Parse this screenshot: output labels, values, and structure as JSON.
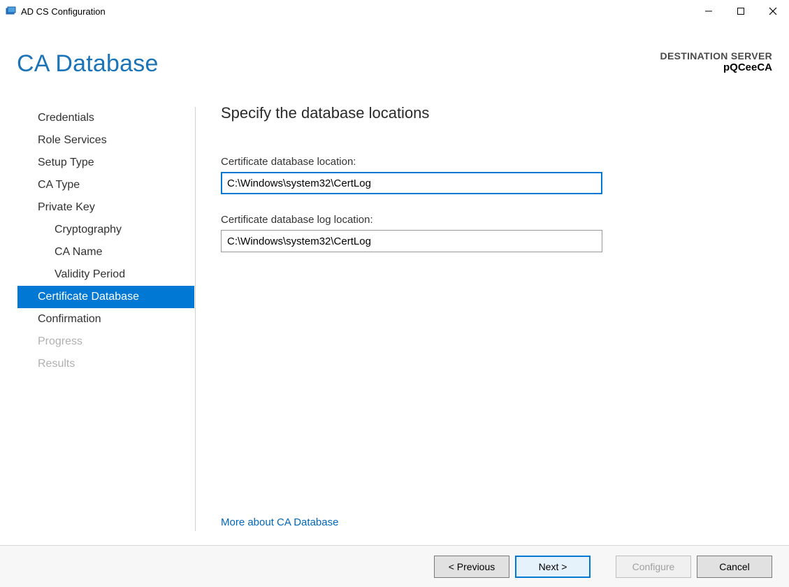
{
  "window": {
    "title": "AD CS Configuration",
    "icon": "server-manager-icon"
  },
  "header": {
    "page_title": "CA Database",
    "destination_label": "DESTINATION SERVER",
    "destination_value": "pQCeeCA"
  },
  "sidebar": {
    "items": [
      {
        "label": "Credentials",
        "sub": false,
        "selected": false,
        "disabled": false
      },
      {
        "label": "Role Services",
        "sub": false,
        "selected": false,
        "disabled": false
      },
      {
        "label": "Setup Type",
        "sub": false,
        "selected": false,
        "disabled": false
      },
      {
        "label": "CA Type",
        "sub": false,
        "selected": false,
        "disabled": false
      },
      {
        "label": "Private Key",
        "sub": false,
        "selected": false,
        "disabled": false
      },
      {
        "label": "Cryptography",
        "sub": true,
        "selected": false,
        "disabled": false
      },
      {
        "label": "CA Name",
        "sub": true,
        "selected": false,
        "disabled": false
      },
      {
        "label": "Validity Period",
        "sub": true,
        "selected": false,
        "disabled": false
      },
      {
        "label": "Certificate Database",
        "sub": false,
        "selected": true,
        "disabled": false
      },
      {
        "label": "Confirmation",
        "sub": false,
        "selected": false,
        "disabled": false
      },
      {
        "label": "Progress",
        "sub": false,
        "selected": false,
        "disabled": true
      },
      {
        "label": "Results",
        "sub": false,
        "selected": false,
        "disabled": true
      }
    ]
  },
  "main": {
    "heading": "Specify the database locations",
    "db_location_label": "Certificate database location:",
    "db_location_value": "C:\\Windows\\system32\\CertLog",
    "db_log_location_label": "Certificate database log location:",
    "db_log_location_value": "C:\\Windows\\system32\\CertLog",
    "help_link": "More about CA Database"
  },
  "footer": {
    "previous": "< Previous",
    "next": "Next >",
    "configure": "Configure",
    "cancel": "Cancel"
  }
}
